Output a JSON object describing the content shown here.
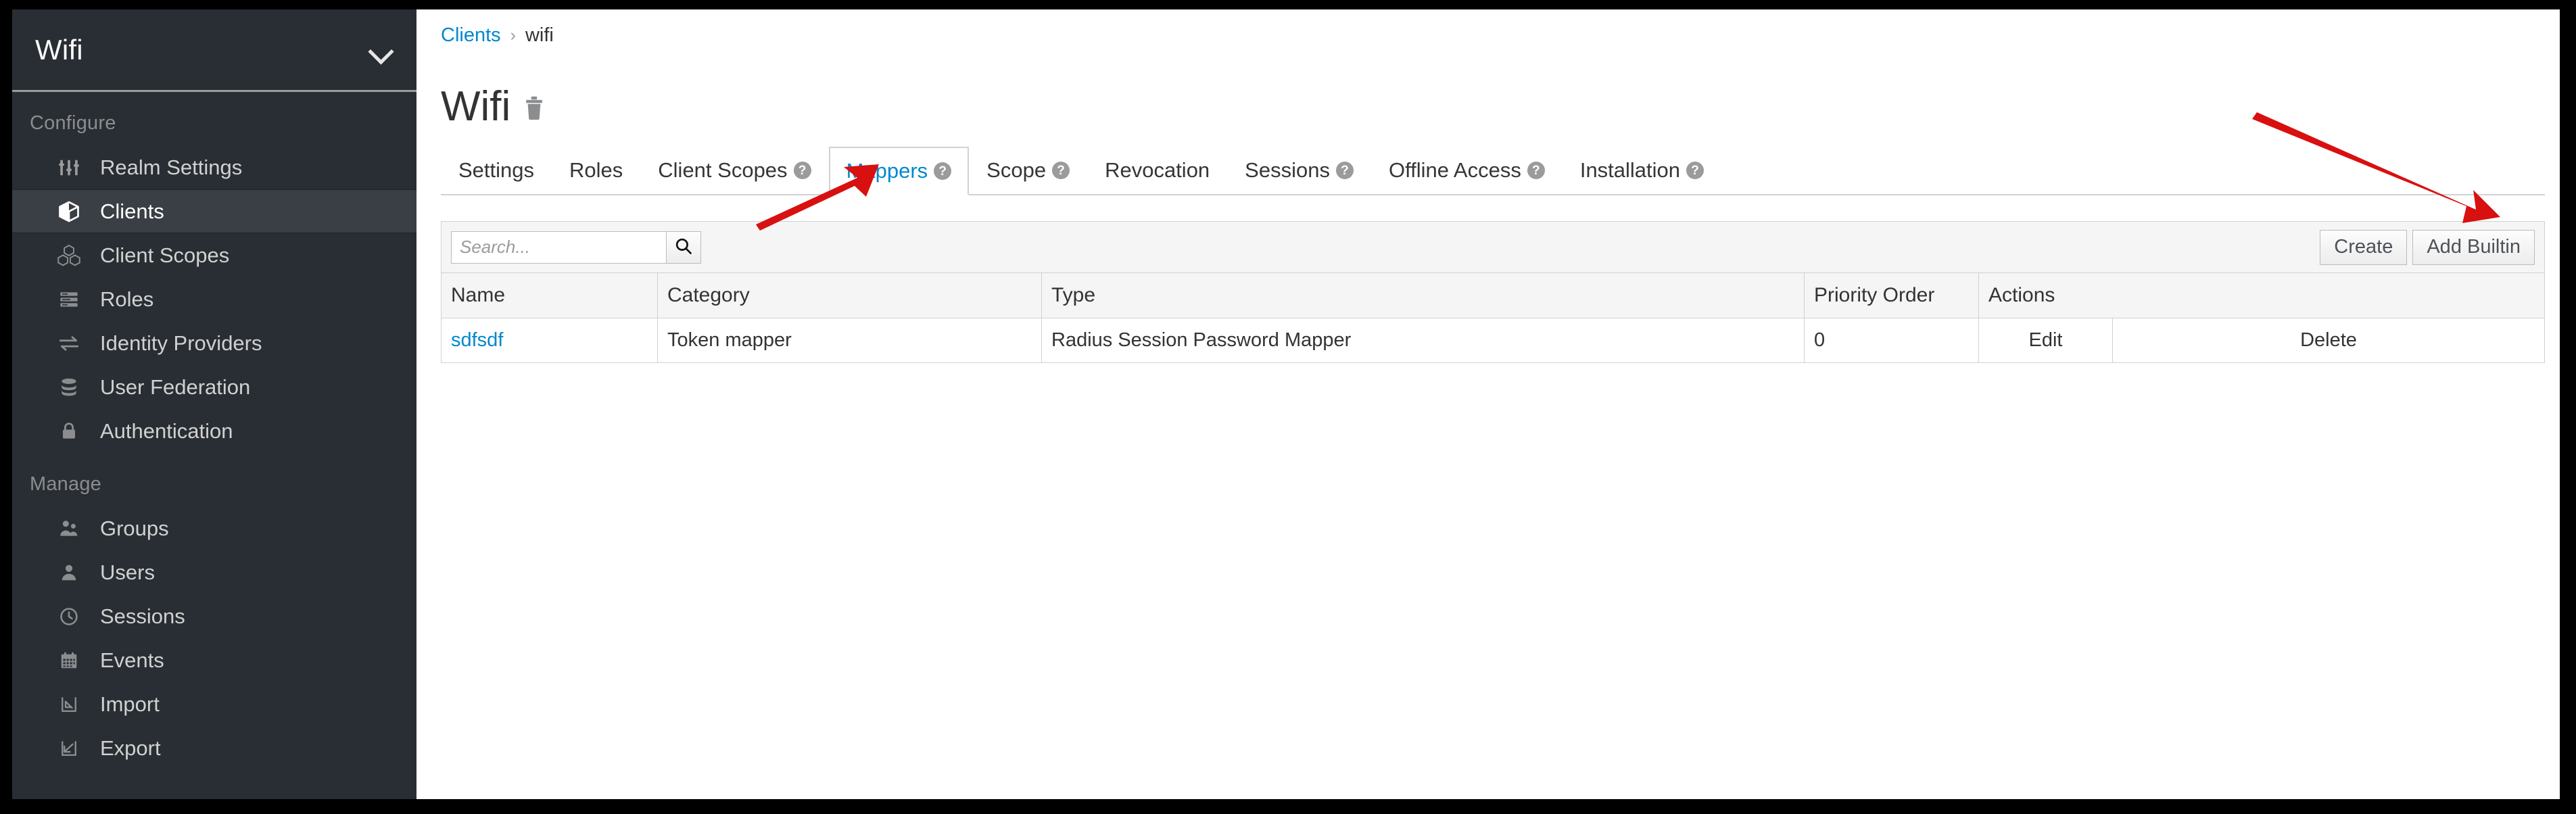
{
  "sidebar": {
    "realm": {
      "name": "Wifi",
      "chevron_icon": "chevron-down-icon"
    },
    "sections": [
      {
        "label": "Configure",
        "items": [
          {
            "label": "Realm Settings",
            "icon": "sliders-icon",
            "active": false
          },
          {
            "label": "Clients",
            "icon": "cube-icon",
            "active": true
          },
          {
            "label": "Client Scopes",
            "icon": "cubes-icon",
            "active": false
          },
          {
            "label": "Roles",
            "icon": "list-icon",
            "active": false
          },
          {
            "label": "Identity Providers",
            "icon": "exchange-icon",
            "active": false
          },
          {
            "label": "User Federation",
            "icon": "database-icon",
            "active": false
          },
          {
            "label": "Authentication",
            "icon": "lock-icon",
            "active": false
          }
        ]
      },
      {
        "label": "Manage",
        "items": [
          {
            "label": "Groups",
            "icon": "users-icon",
            "active": false
          },
          {
            "label": "Users",
            "icon": "user-icon",
            "active": false
          },
          {
            "label": "Sessions",
            "icon": "clock-icon",
            "active": false
          },
          {
            "label": "Events",
            "icon": "calendar-icon",
            "active": false
          },
          {
            "label": "Import",
            "icon": "import-icon",
            "active": false
          },
          {
            "label": "Export",
            "icon": "export-icon",
            "active": false
          }
        ]
      }
    ]
  },
  "breadcrumb": {
    "parent": "Clients",
    "separator": "›",
    "current": "wifi"
  },
  "page": {
    "title": "Wifi",
    "delete_icon": "trash-icon"
  },
  "tabs": [
    {
      "label": "Settings",
      "help": false,
      "active": false
    },
    {
      "label": "Roles",
      "help": false,
      "active": false
    },
    {
      "label": "Client Scopes",
      "help": true,
      "active": false
    },
    {
      "label": "Mappers",
      "help": true,
      "active": true
    },
    {
      "label": "Scope",
      "help": true,
      "active": false
    },
    {
      "label": "Revocation",
      "help": false,
      "active": false
    },
    {
      "label": "Sessions",
      "help": true,
      "active": false
    },
    {
      "label": "Offline Access",
      "help": true,
      "active": false
    },
    {
      "label": "Installation",
      "help": true,
      "active": false
    }
  ],
  "toolbar": {
    "search_placeholder": "Search...",
    "search_value": "",
    "search_icon": "search-icon",
    "create_label": "Create",
    "add_builtin_label": "Add Builtin"
  },
  "table": {
    "columns": [
      "Name",
      "Category",
      "Type",
      "Priority Order",
      "Actions"
    ],
    "rows": [
      {
        "name": "sdfsdf",
        "category": "Token mapper",
        "type": "Radius Session Password Mapper",
        "priority_order": "0",
        "edit_label": "Edit",
        "delete_label": "Delete"
      }
    ]
  },
  "annotations": {
    "arrow_color": "#d81010",
    "arrow_1_target": "Mappers",
    "arrow_2_target": "Add Builtin"
  },
  "colors": {
    "sidebar_bg": "#292e34",
    "sidebar_active_bg": "#393f44",
    "link": "#0088ce",
    "frame": "#000000",
    "toolbar_bg": "#f5f5f5",
    "border": "#d1d1d1"
  }
}
